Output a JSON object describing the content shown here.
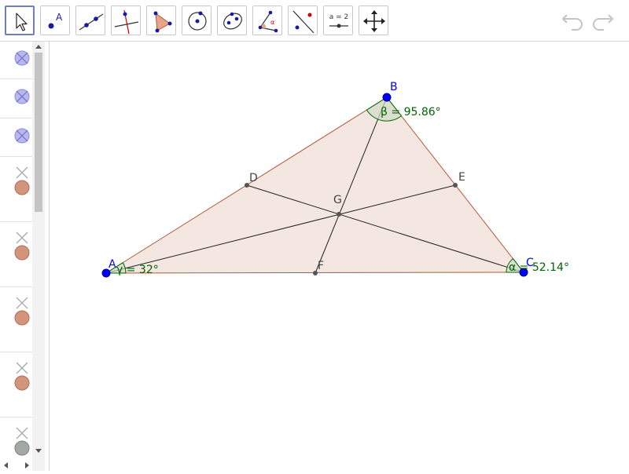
{
  "toolbar": {
    "tools": [
      {
        "name": "move-tool",
        "icon": "cursor-arrow-icon",
        "selected": true
      },
      {
        "name": "point-tool",
        "icon": "point-icon",
        "label": "A"
      },
      {
        "name": "line-tool",
        "icon": "line-through-points-icon"
      },
      {
        "name": "perpendicular-tool",
        "icon": "perpendicular-line-icon"
      },
      {
        "name": "polygon-tool",
        "icon": "polygon-icon"
      },
      {
        "name": "circle-tool",
        "icon": "circle-center-point-icon"
      },
      {
        "name": "ellipse-tool",
        "icon": "ellipse-icon"
      },
      {
        "name": "angle-tool",
        "icon": "angle-icon"
      },
      {
        "name": "reflect-tool",
        "icon": "reflect-about-line-icon"
      },
      {
        "name": "slider-tool",
        "icon": "slider-icon",
        "label": "a = 2"
      },
      {
        "name": "move-graphics-tool",
        "icon": "move-graphics-view-icon"
      }
    ],
    "undo_icon": "undo-icon",
    "redo_icon": "redo-icon"
  },
  "algebra": {
    "rows": [
      {
        "kind": "hidden-object",
        "color": "#8a8ae0"
      },
      {
        "kind": "hidden-object",
        "color": "#8a8ae0"
      },
      {
        "kind": "hidden-object",
        "color": "#8a8ae0"
      },
      {
        "kind": "object",
        "color": "#d2947a"
      },
      {
        "kind": "object",
        "color": "#d2947a"
      },
      {
        "kind": "object",
        "color": "#d2947a"
      },
      {
        "kind": "object",
        "color": "#d2947a"
      },
      {
        "kind": "object",
        "color": "#a4a8a4"
      }
    ]
  },
  "geometry": {
    "points": {
      "A": {
        "label": "A"
      },
      "B": {
        "label": "B"
      },
      "C": {
        "label": "C"
      },
      "D": {
        "label": "D"
      },
      "E": {
        "label": "E"
      },
      "F": {
        "label": "F"
      },
      "G": {
        "label": "G"
      }
    },
    "angles": {
      "alpha": "α = 52.14°",
      "beta": "β = 95.86°",
      "gamma": "γ = 32°"
    },
    "colors": {
      "triangle_fill": "#f4e6e1",
      "triangle_edge": "#b05a3c",
      "free_point": "#0000ff",
      "angle_color": "#006400",
      "label_dark": "#444444"
    }
  }
}
